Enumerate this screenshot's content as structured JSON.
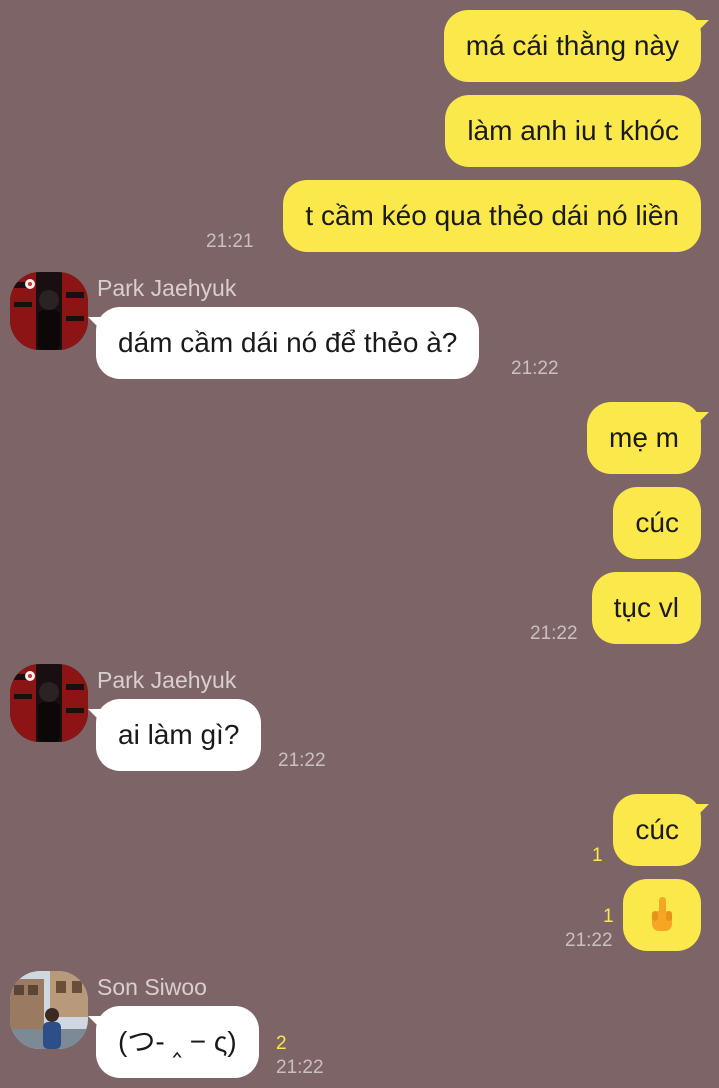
{
  "messages": {
    "m1": {
      "text": "má cái thằng này"
    },
    "m2": {
      "text": "làm anh iu t khóc"
    },
    "m3": {
      "text": "t cầm kéo qua thẻo dái nó liền",
      "time": "21:21"
    },
    "g1": {
      "sender": "Park Jaehyuk",
      "text": "dám cầm dái nó để thẻo à?",
      "time": "21:22"
    },
    "m4": {
      "text": "mẹ m"
    },
    "m5": {
      "text": "cúc"
    },
    "m6": {
      "text": "tục vl",
      "time": "21:22"
    },
    "g2": {
      "sender": "Park Jaehyuk",
      "text": "ai làm gì?",
      "time": "21:22"
    },
    "m7": {
      "text": "cúc",
      "unread": "1"
    },
    "m8": {
      "emoji": "middle-finger-emoji",
      "unread": "1",
      "time": "21:22"
    },
    "g3": {
      "sender": "Son Siwoo",
      "text": "(つ- ‸ − ς)",
      "unread": "2",
      "time": "21:22"
    }
  },
  "colors": {
    "background": "#7c6467",
    "my_bubble": "#fbe84a",
    "their_bubble": "#ffffff",
    "unread_count": "#fbe84a"
  }
}
